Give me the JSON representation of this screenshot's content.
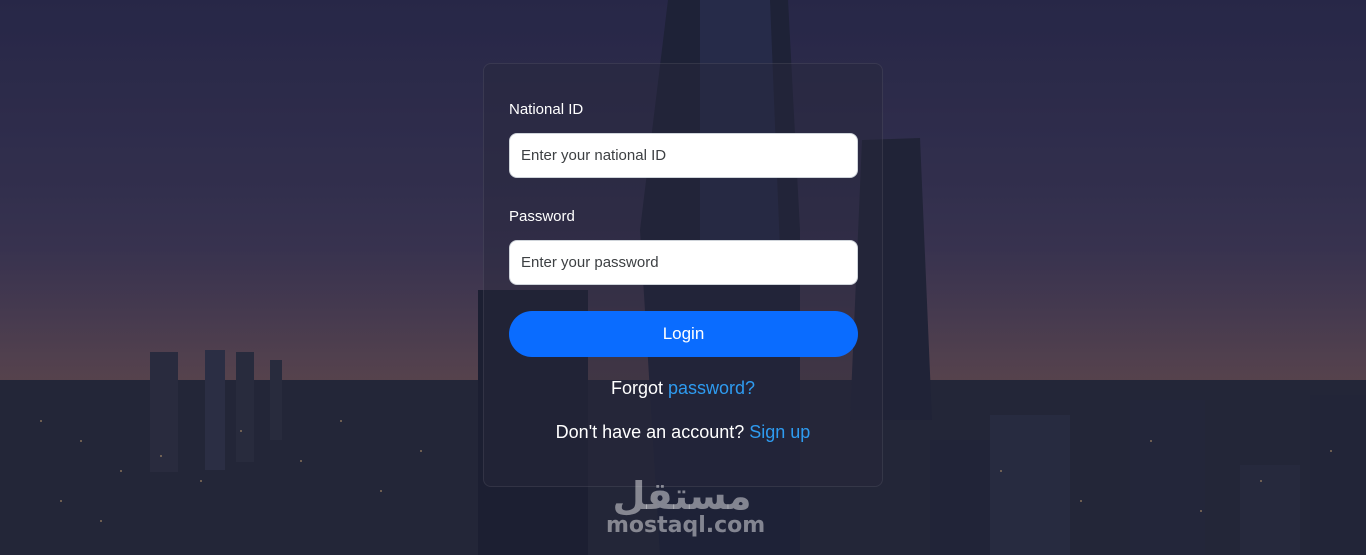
{
  "form": {
    "national_id_label": "National ID",
    "national_id_placeholder": "Enter your national ID",
    "national_id_value": "",
    "password_label": "Password",
    "password_placeholder": "Enter your password",
    "password_value": "",
    "login_label": "Login",
    "forgot_prefix": "Forgot",
    "forgot_link": "password?",
    "signup_prefix": "Don't have an account?",
    "signup_link": "Sign up"
  },
  "watermark": {
    "arabic": "مستقل",
    "latin": "mostaql.com"
  },
  "colors": {
    "primary": "#0a6cff",
    "link": "#2e9bf0",
    "background": "#2b2b4e"
  }
}
